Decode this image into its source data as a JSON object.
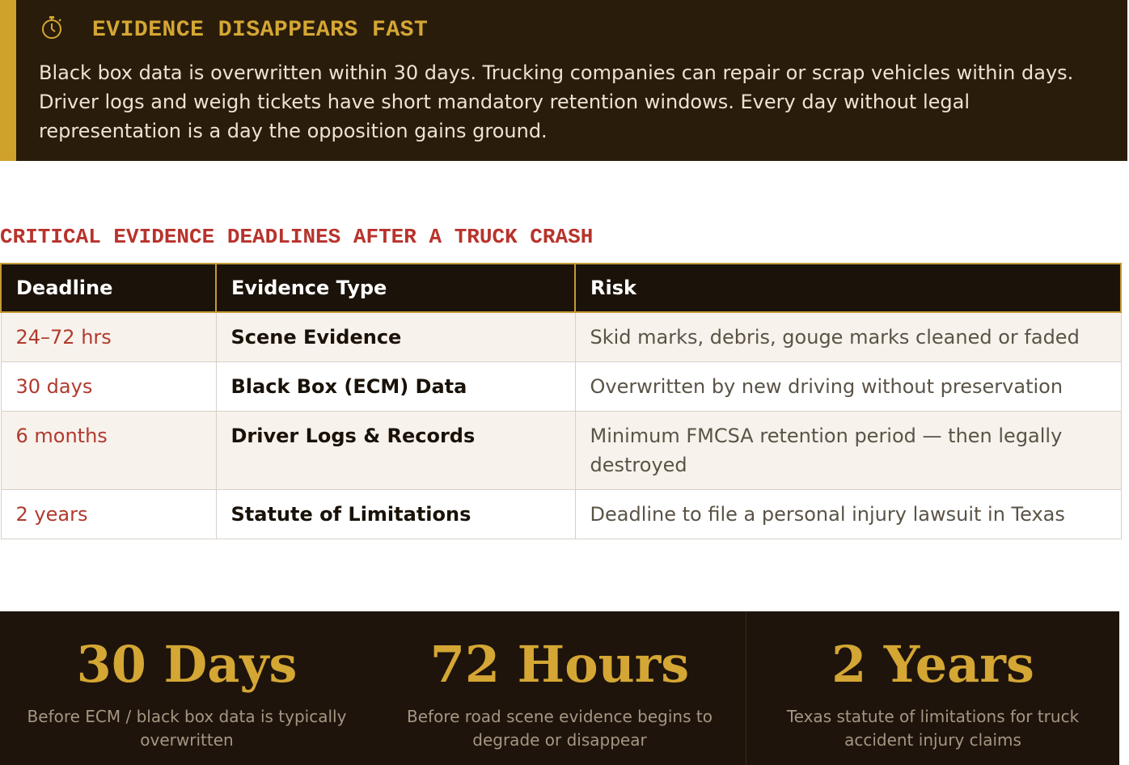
{
  "alert": {
    "icon": "stopwatch-icon",
    "title": "EVIDENCE DISAPPEARS FAST",
    "body": "Black box data is overwritten within 30 days. Trucking companies can repair or scrap vehicles within days. Driver logs and weigh tickets have short mandatory retention windows. Every day without legal representation is a day the opposition gains ground.",
    "accent_color": "#cfa22c",
    "background_color": "#2a1c0a"
  },
  "section": {
    "title": "CRITICAL EVIDENCE DEADLINES AFTER A TRUCK CRASH",
    "color": "#b8332c"
  },
  "table": {
    "headers": [
      "Deadline",
      "Evidence Type",
      "Risk"
    ],
    "rows": [
      {
        "deadline": "24–72 hrs",
        "type": "Scene Evidence",
        "risk": "Skid marks, debris, gouge marks cleaned or faded"
      },
      {
        "deadline": "30 days",
        "type": "Black Box (ECM) Data",
        "risk": "Overwritten by new driving without preservation"
      },
      {
        "deadline": "6 months",
        "type": "Driver Logs & Records",
        "risk": "Minimum FMCSA retention period — then legally destroyed"
      },
      {
        "deadline": "2 years",
        "type": "Statute of Limitations",
        "risk": "Deadline to file a personal injury lawsuit in Texas"
      }
    ]
  },
  "stats": [
    {
      "value": "30 Days",
      "label": "Before ECM / black box data is typically overwritten"
    },
    {
      "value": "72 Hours",
      "label": "Before road scene evidence begins to degrade or disappear"
    },
    {
      "value": "2 Years",
      "label": "Texas statute of limitations for truck accident injury claims"
    }
  ]
}
